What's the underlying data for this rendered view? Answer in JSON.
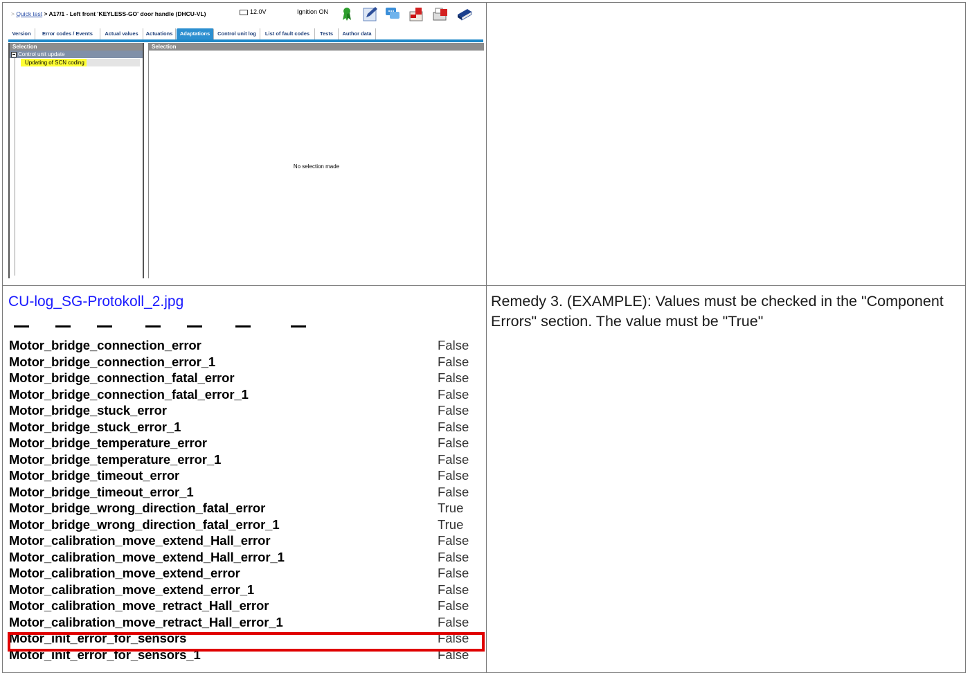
{
  "screenshot": {
    "breadcrumb_prefix": ">",
    "breadcrumb_link": "Quick test",
    "breadcrumb_title": "> A17/1 - Left front 'KEYLESS-GO' door handle (DHCU-VL)",
    "voltage": "12.0V",
    "ignition": "Ignition ON",
    "tabs": [
      {
        "label": "Version"
      },
      {
        "label": "Error codes / Events"
      },
      {
        "label": "Actual values"
      },
      {
        "label": "Actuations"
      },
      {
        "label": "Adaptations",
        "active": true
      },
      {
        "label": "Control unit log"
      },
      {
        "label": "List of fault codes"
      },
      {
        "label": "Tests"
      },
      {
        "label": "Author data"
      }
    ],
    "left_header": "Selection",
    "right_header": "Selection",
    "tree_parent": "Control unit update",
    "tree_child": "Updating of SCN coding",
    "empty_message": "No selection made",
    "icons": [
      "ribbon-icon",
      "edit-icon",
      "chat-icon",
      "pdf-export-icon",
      "pdf-print-icon",
      "manual-book-icon"
    ],
    "accent_color": "#1e88c8",
    "highlight_color": "#ffff33"
  },
  "log": {
    "file_link": "CU-log_SG-Protokoll_2.jpg",
    "rows": [
      {
        "name": "Motor_bridge_connection_error",
        "value": "False"
      },
      {
        "name": "Motor_bridge_connection_error_1",
        "value": "False"
      },
      {
        "name": "Motor_bridge_connection_fatal_error",
        "value": "False"
      },
      {
        "name": "Motor_bridge_connection_fatal_error_1",
        "value": "False"
      },
      {
        "name": "Motor_bridge_stuck_error",
        "value": "False"
      },
      {
        "name": "Motor_bridge_stuck_error_1",
        "value": "False"
      },
      {
        "name": "Motor_bridge_temperature_error",
        "value": "False"
      },
      {
        "name": "Motor_bridge_temperature_error_1",
        "value": "False"
      },
      {
        "name": "Motor_bridge_timeout_error",
        "value": "False"
      },
      {
        "name": "Motor_bridge_timeout_error_1",
        "value": "False"
      },
      {
        "name": "Motor_bridge_wrong_direction_fatal_error",
        "value": "True"
      },
      {
        "name": "Motor_bridge_wrong_direction_fatal_error_1",
        "value": "True"
      },
      {
        "name": "Motor_calibration_move_extend_Hall_error",
        "value": "False"
      },
      {
        "name": "Motor_calibration_move_extend_Hall_error_1",
        "value": "False"
      },
      {
        "name": "Motor_calibration_move_extend_error",
        "value": "False"
      },
      {
        "name": "Motor_calibration_move_extend_error_1",
        "value": "False"
      },
      {
        "name": "Motor_calibration_move_retract_Hall_error",
        "value": "False"
      },
      {
        "name": "Motor_calibration_move_retract_Hall_error_1",
        "value": "False"
      },
      {
        "name": "Motor_init_error_for_sensors",
        "value": "False",
        "highlighted": true
      },
      {
        "name": "Motor_init_error_for_sensors_1",
        "value": "False"
      }
    ],
    "highlight_border_color": "#e00000"
  },
  "remedy": {
    "text": "Remedy 3. (EXAMPLE): Values must be checked in the \"Component Errors\" section. The value must be \"True\""
  }
}
